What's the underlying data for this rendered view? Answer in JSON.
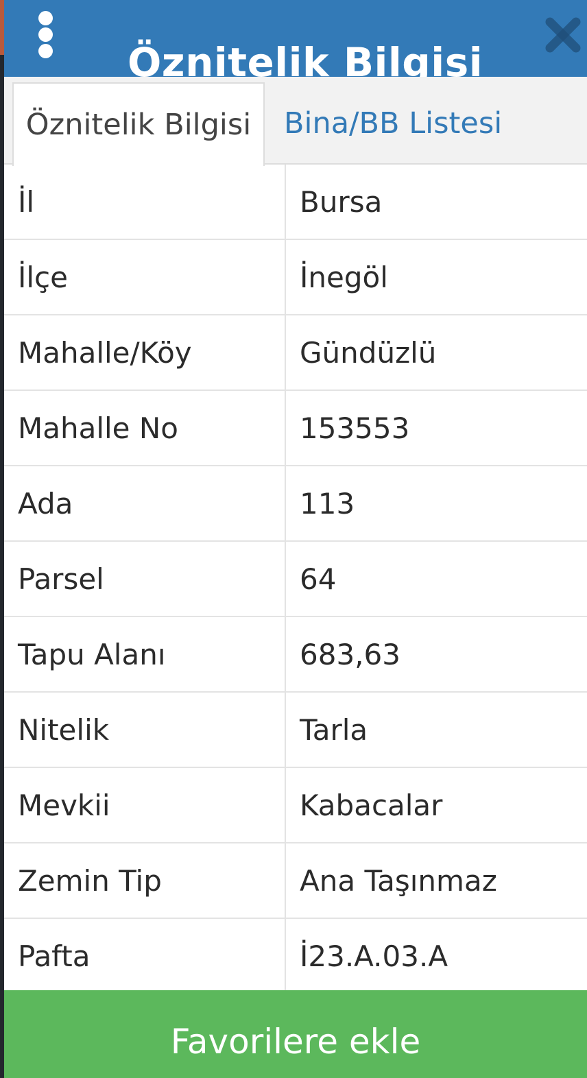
{
  "header": {
    "title": "Öznitelik Bilgisi",
    "menu_icon": "kebab-menu-icon",
    "close_icon": "close-icon",
    "color": "#337ab7"
  },
  "tabs": [
    {
      "label": "Öznitelik Bilgisi",
      "active": true
    },
    {
      "label": "Bina/BB Listesi",
      "active": false
    }
  ],
  "attributes": [
    {
      "key": "İl",
      "value": "Bursa"
    },
    {
      "key": "İlçe",
      "value": "İnegöl"
    },
    {
      "key": "Mahalle/Köy",
      "value": "Gündüzlü"
    },
    {
      "key": "Mahalle No",
      "value": "153553"
    },
    {
      "key": "Ada",
      "value": "113"
    },
    {
      "key": "Parsel",
      "value": "64"
    },
    {
      "key": "Tapu Alanı",
      "value": "683,63"
    },
    {
      "key": "Nitelik",
      "value": "Tarla"
    },
    {
      "key": "Mevkii",
      "value": "Kabacalar"
    },
    {
      "key": "Zemin Tip",
      "value": "Ana Taşınmaz"
    },
    {
      "key": "Pafta",
      "value": "İ23.A.03.A"
    }
  ],
  "footer": {
    "favorite_label": "Favorilere ekle",
    "color": "#5cb85c"
  }
}
